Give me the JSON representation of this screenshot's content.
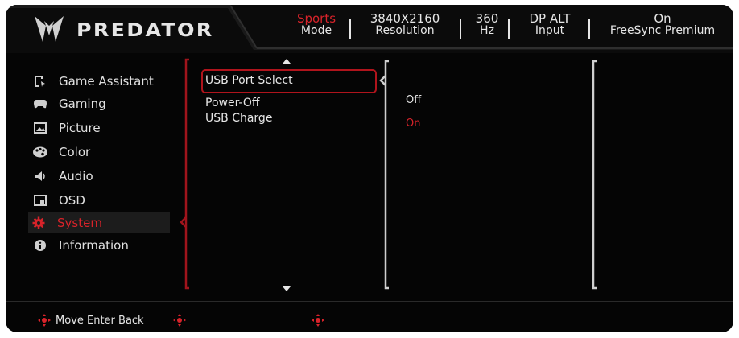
{
  "brand": {
    "name": "PREDATOR"
  },
  "status": [
    {
      "value": "Sports",
      "label": "Mode",
      "highlight": true
    },
    {
      "value": "3840X2160",
      "label": "Resolution",
      "highlight": false
    },
    {
      "value": "360",
      "label": "Hz",
      "highlight": false
    },
    {
      "value": "DP ALT",
      "label": "Input",
      "highlight": false
    },
    {
      "value": "On",
      "label": "FreeSync Premium",
      "highlight": false
    }
  ],
  "menu": [
    {
      "label": "Game Assistant",
      "icon": "game-assistant-icon"
    },
    {
      "label": "Gaming",
      "icon": "gamepad-icon"
    },
    {
      "label": "Picture",
      "icon": "picture-icon"
    },
    {
      "label": "Color",
      "icon": "color-palette-icon"
    },
    {
      "label": "Audio",
      "icon": "speaker-icon"
    },
    {
      "label": "OSD",
      "icon": "osd-icon"
    },
    {
      "label": "System",
      "icon": "gear-icon",
      "active": true
    },
    {
      "label": "Information",
      "icon": "info-icon"
    }
  ],
  "submenu": {
    "selected": "USB Port Select",
    "items": [
      "Power-Off",
      "USB Charge"
    ]
  },
  "options": {
    "items": [
      "Off",
      "On"
    ],
    "active": "On"
  },
  "footer": {
    "hint": "Move Enter Back"
  },
  "colors": {
    "accent": "#d8232a",
    "background": "#050505",
    "text": "#e6e6e6"
  }
}
